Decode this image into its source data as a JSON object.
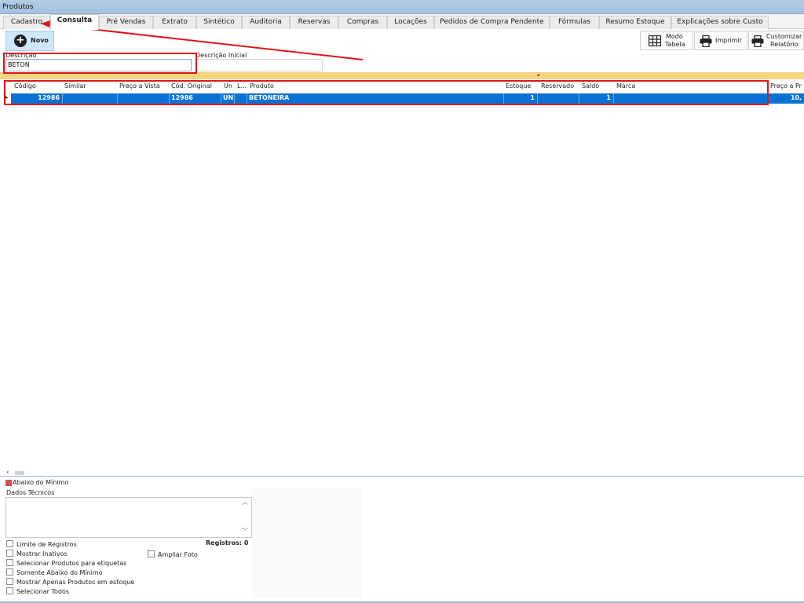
{
  "window": {
    "title": "Produtos"
  },
  "tabs": [
    "Cadastro",
    "Consulta",
    "Pré Vendas",
    "Extrato",
    "Sintético",
    "Auditoria",
    "Reservas",
    "Compras",
    "Locações",
    "Pedidos de Compra Pendente",
    "Fórmulas",
    "Resumo Estoque",
    "Explicações sobre Custo"
  ],
  "active_tab": "Consulta",
  "toolbar": {
    "novo": "Novo",
    "modo_tabela_line1": "Modo",
    "modo_tabela_line2": "Tabela",
    "imprimir": "Imprimir",
    "customizar_line1": "Customizar",
    "customizar_line2": "Relatório"
  },
  "filters": {
    "descricao_label": "Descrição",
    "descricao_value": "BETON",
    "descricao_inicial_label": "Descrição Inicial",
    "descricao_inicial_value": ""
  },
  "grid": {
    "headers": {
      "codigo": "Código",
      "similar": "Similar",
      "preco_vista": "Preço a Vista",
      "cod_original": "Cód. Original",
      "un": "Un",
      "l": "L...",
      "produto": "Produto",
      "estoque": "Estoque",
      "reservado": "Reservado",
      "saldo": "Saldo",
      "marca": "Marca",
      "preco_prazo": "Preço a Pr"
    },
    "row": {
      "codigo": "12986",
      "similar": "",
      "preco_vista": "",
      "cod_original": "12986",
      "un": "UN",
      "l": "",
      "produto": "BETONEIRA",
      "estoque": "1",
      "reservado": "",
      "saldo": "1",
      "marca": "",
      "preco_prazo": "10,"
    }
  },
  "bottom": {
    "legend_abaixo": "Abaixo do Mínimo",
    "dados_tecnicos": "Dados Técnicos",
    "registros": "Registros: 0",
    "checkboxes": [
      "Limite de Registros",
      "Mostrar Inativos",
      "Selecionar Produtos para etiquetas",
      "Somente Abaixo do Mínimo",
      "Mostrar Apenas Produtos em estoque",
      "Selecionar Todos"
    ],
    "ampliar_foto": "Ampliar Foto"
  },
  "colors": {
    "selection": "#0a72d4",
    "annotation": "#e0141a",
    "strip": "#f8d47e"
  }
}
